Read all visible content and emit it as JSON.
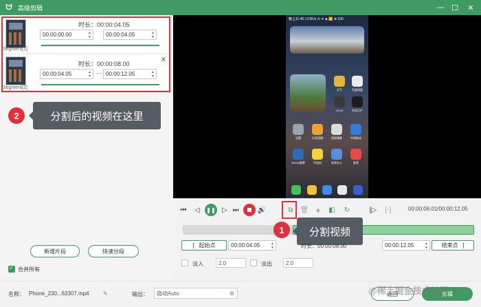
{
  "window": {
    "title": "高级剪辑",
    "minimize": "—",
    "maximize": "☐",
    "close": "✕"
  },
  "segments": [
    {
      "label": "Segment[1]",
      "duration": "时长：00:00:04.05",
      "start": "00:00:00.00",
      "end": "00:00:04.05",
      "progress": 1.0
    },
    {
      "label": "Segment[2]",
      "duration": "时长：00:00:08.00",
      "start": "00:00:04.05",
      "end": "00:00:12.05",
      "progress": 1.0
    }
  ],
  "segment_separator": "—",
  "callouts": {
    "one": {
      "num": "1",
      "text": "分割视频"
    },
    "two": {
      "num": "2",
      "text": "分割后的视频在这里"
    }
  },
  "left_buttons": {
    "add_segment": "新增片段",
    "quick_split": "快速分段"
  },
  "merge_all": {
    "label": "合并所有",
    "checked": true
  },
  "player": {
    "time": "00:00:06.01/00:00:12.05"
  },
  "phone": {
    "status": "晚上11:46 | 0.0K/s ⊙ ✈ ◈ 📶 ⊕ 100",
    "apps": [
      {
        "label": "天气"
      },
      {
        "label": "百度网盘"
      },
      {
        "label": "JOOX"
      },
      {
        "label": "东风日产"
      },
      {
        "label": "设置"
      },
      {
        "label": "抖音直播"
      },
      {
        "label": "网易播客"
      },
      {
        "label": "中国移动"
      },
      {
        "label": "BOSS直聘"
      },
      {
        "label": "不挂科"
      },
      {
        "label": "效率办公"
      },
      {
        "label": "推荐"
      }
    ]
  },
  "trim": {
    "start_label": "起始点",
    "start_value": "00:00:04.05",
    "duration_label": "时长：00:00:08.00",
    "end_value": "00:00:12.05",
    "end_label": "结束点",
    "bracket_left": "[",
    "bracket_right": "]"
  },
  "fade": {
    "in_label": "淡入",
    "in_value": "2.0",
    "out_label": "淡出",
    "out_value": "2.0",
    "in_checked": false,
    "out_checked": false
  },
  "bottom": {
    "name_label": "名称：",
    "name_value": "Phone_230...63307.mp4",
    "output_label": "输出：",
    "output_value": "自动Auto",
    "back_button": "返回",
    "export_button": "剪辑"
  },
  "watermark": "@稀土掘金技术社区",
  "colors": {
    "accent": "#3f9a63",
    "callout_red": "#e0303a"
  }
}
